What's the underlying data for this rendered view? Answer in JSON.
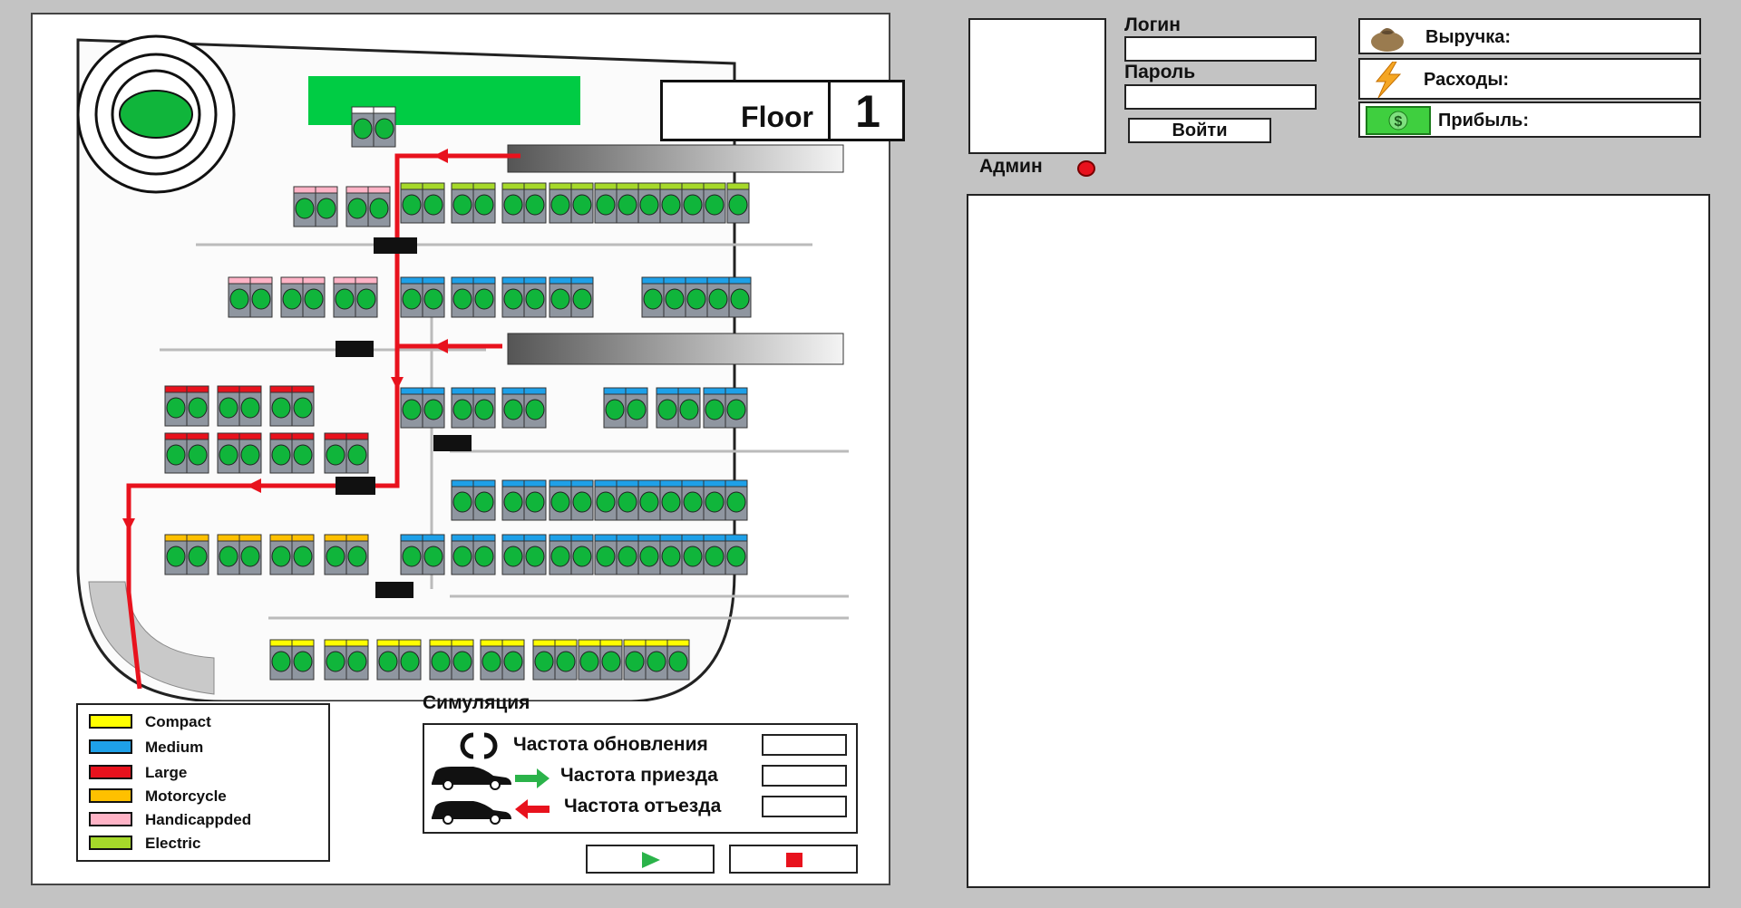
{
  "floor": {
    "label": "Floor",
    "number": "1"
  },
  "legend": [
    {
      "label": "Compact",
      "color": "#ffff00"
    },
    {
      "label": "Medium",
      "color": "#1ea0e8"
    },
    {
      "label": "Large",
      "color": "#e8121d"
    },
    {
      "label": "Motorcycle",
      "color": "#ffc000"
    },
    {
      "label": "Handicappded",
      "color": "#ffb3c6"
    },
    {
      "label": "Electric",
      "color": "#a6d92a"
    }
  ],
  "simulation": {
    "title": "Симуляция",
    "update_rate_label": "Частота обновления",
    "arrival_rate_label": "Частота приезда",
    "departure_rate_label": "Частота отъезда",
    "update_rate_value": "",
    "arrival_rate_value": "",
    "departure_rate_value": ""
  },
  "controls": {
    "play_icon": "play-icon",
    "stop_icon": "stop-icon"
  },
  "auth": {
    "login_label": "Логин",
    "password_label": "Пароль",
    "login_value": "",
    "password_value": "",
    "login_button": "Войти",
    "admin_label": "Админ",
    "admin_status_color": "#e8121d"
  },
  "stats": {
    "revenue_label": "Выручка:",
    "expenses_label": "Расходы:",
    "profit_label": "Прибыль:",
    "revenue_icon": "money-bag-icon",
    "expenses_icon": "lightning-icon",
    "profit_icon": "dollar-bill-icon"
  },
  "colors": {
    "occupied": "#10b53b",
    "route": "#e8121d",
    "ramp_green": "#00cc44"
  }
}
